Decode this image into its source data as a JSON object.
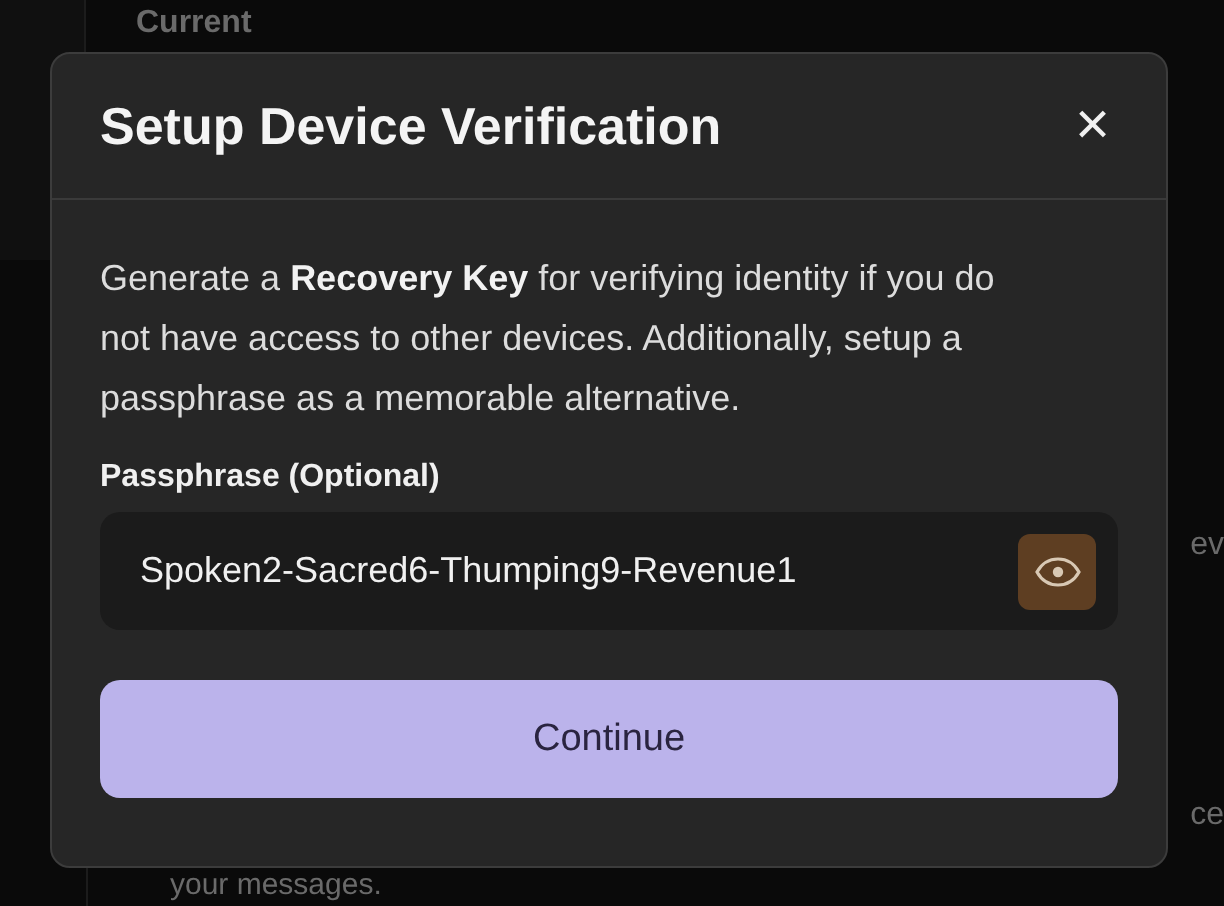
{
  "background": {
    "heading": "Current",
    "fragments": [
      "ev",
      "ce"
    ],
    "footer_text": "your messages."
  },
  "dialog": {
    "title": "Setup Device Verification",
    "close": "×",
    "description": "Generate a **Recovery Key** for verifying identity if you do not have access to other devices. Additionally, setup a passphrase as a memorable alternative.",
    "field": {
      "label": "Passphrase (Optional)",
      "value": "Spoken2-Sacred6-Thumping9-Revenue1",
      "revealed": true
    },
    "button": "Continue"
  }
}
